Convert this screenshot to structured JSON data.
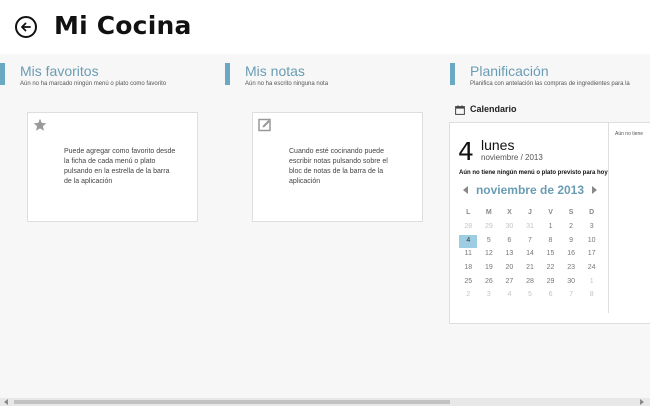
{
  "header": {
    "title": "Mi Cocina"
  },
  "favorites": {
    "title": "Mis favoritos",
    "subtitle": "Aún no ha marcado ningún menú o plato como favorito",
    "card_text": "Puede agregar como favorito desde la ficha de cada menú o plato pulsando en la estrella de la barra de la aplicación"
  },
  "notes": {
    "title": "Mis notas",
    "subtitle": "Aún no ha escrito ninguna nota",
    "card_text": "Cuando esté cocinando puede escribir notas pulsando sobre el bloc de notas de la barra de la aplicación"
  },
  "planning": {
    "title": "Planificación",
    "subtitle": "Planifica con antelación las compras de ingredientes para la",
    "calendar_label": "Calendario",
    "day_number": "4",
    "day_name": "lunes",
    "month_year": "noviembre / 2013",
    "no_plan": "Aún no tiene ningún menú o plato previsto para hoy",
    "month_label": "noviembre de 2013",
    "right_text": "Aún no tiene",
    "weekdays": [
      "L",
      "M",
      "X",
      "J",
      "V",
      "S",
      "D"
    ],
    "weeks": [
      [
        {
          "d": "28",
          "o": true
        },
        {
          "d": "29",
          "o": true
        },
        {
          "d": "30",
          "o": true
        },
        {
          "d": "31",
          "o": true
        },
        {
          "d": "1"
        },
        {
          "d": "2"
        },
        {
          "d": "3"
        }
      ],
      [
        {
          "d": "4",
          "t": true
        },
        {
          "d": "5"
        },
        {
          "d": "6"
        },
        {
          "d": "7"
        },
        {
          "d": "8"
        },
        {
          "d": "9"
        },
        {
          "d": "10"
        }
      ],
      [
        {
          "d": "11"
        },
        {
          "d": "12"
        },
        {
          "d": "13"
        },
        {
          "d": "14"
        },
        {
          "d": "15"
        },
        {
          "d": "16"
        },
        {
          "d": "17"
        }
      ],
      [
        {
          "d": "18"
        },
        {
          "d": "19"
        },
        {
          "d": "20"
        },
        {
          "d": "21"
        },
        {
          "d": "22"
        },
        {
          "d": "23"
        },
        {
          "d": "24"
        }
      ],
      [
        {
          "d": "25"
        },
        {
          "d": "26"
        },
        {
          "d": "27"
        },
        {
          "d": "28"
        },
        {
          "d": "29"
        },
        {
          "d": "30"
        },
        {
          "d": "1",
          "o": true
        }
      ],
      [
        {
          "d": "2",
          "o": true
        },
        {
          "d": "3",
          "o": true
        },
        {
          "d": "4",
          "o": true
        },
        {
          "d": "5",
          "o": true
        },
        {
          "d": "6",
          "o": true
        },
        {
          "d": "7",
          "o": true
        },
        {
          "d": "8",
          "o": true
        }
      ]
    ]
  },
  "colors": {
    "accent": "#6a9cb3",
    "today": "#9ccde3",
    "bar": "#6aa8c4"
  }
}
